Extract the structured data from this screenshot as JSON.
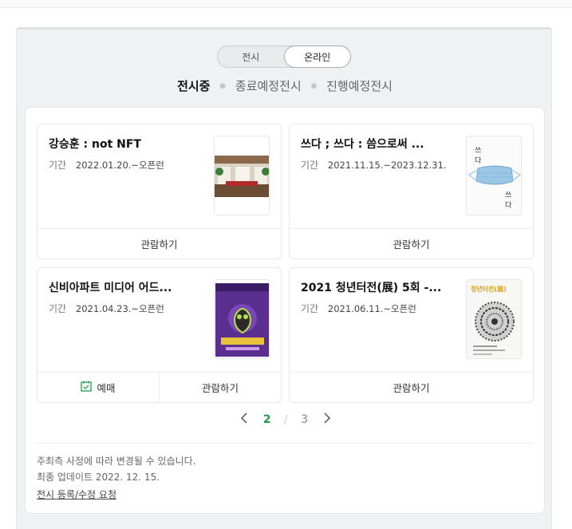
{
  "tabs": [
    {
      "label": "전시",
      "active": false
    },
    {
      "label": "온라인",
      "active": true
    }
  ],
  "filters": [
    {
      "label": "전시중",
      "active": true
    },
    {
      "label": "종료예정전시",
      "active": false
    },
    {
      "label": "진행예정전시",
      "active": false
    }
  ],
  "period_label": "기간",
  "cards": [
    {
      "title": "강승훈 : not NFT",
      "period": "2022.01.20.~오픈런",
      "actions": [
        "관람하기"
      ],
      "thumb": "gallery-photo"
    },
    {
      "title": "쓰다 ; 쓰다 : 씀으로써 ...",
      "period": "2021.11.15.~2023.12.31.",
      "actions": [
        "관람하기"
      ],
      "thumb": "mask-poster",
      "poster_text": [
        "쓰",
        "다",
        "쓰",
        "다"
      ]
    },
    {
      "title": "신비아파트 미디어 어드...",
      "period": "2021.04.23.~오픈런",
      "actions": [
        "예매",
        "관람하기"
      ],
      "thumb": "purple-poster"
    },
    {
      "title": "2021 청년터전(展) 5회 -...",
      "period": "2021.06.11.~오픈런",
      "actions": [
        "관람하기"
      ],
      "thumb": "mandala-poster",
      "poster_text": [
        "청년터전(展)"
      ]
    }
  ],
  "pagination": {
    "current": "2",
    "separator": "/",
    "total": "3"
  },
  "notes": {
    "line1": "주최측 사정에 따라 변경될 수 있습니다.",
    "line2": "최종 업데이트 2022. 12. 15.",
    "link": "전시 등록/수정 요청"
  },
  "colors": {
    "accent": "#19a047",
    "panel": "#f0f1f3"
  }
}
